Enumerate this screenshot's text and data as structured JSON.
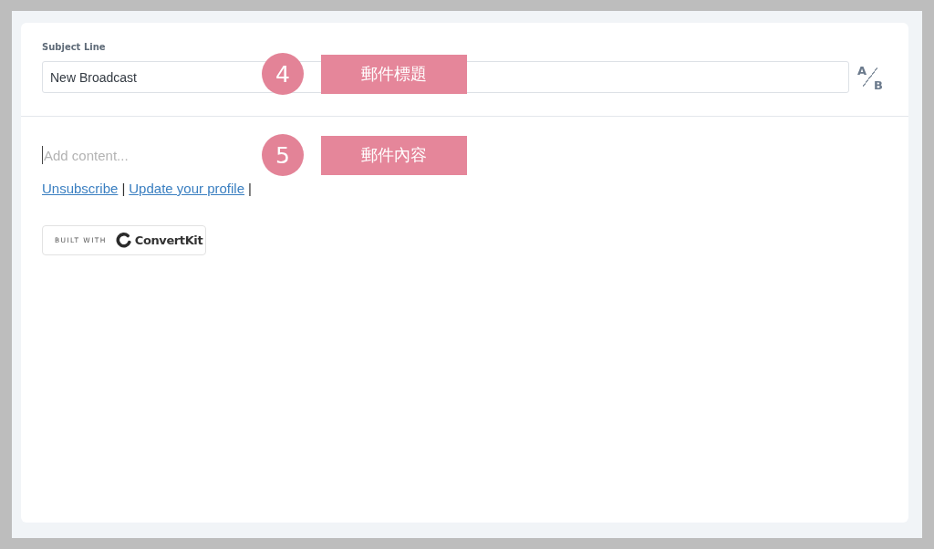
{
  "subject": {
    "label": "Subject Line",
    "value": "New Broadcast",
    "ab_test": {
      "first": "A",
      "second": "B"
    },
    "annotation": {
      "number": "4",
      "label": "郵件標題"
    }
  },
  "editor": {
    "placeholder": "Add content...",
    "footer": [
      {
        "kind": "link",
        "text": "Unsubscribe"
      },
      {
        "kind": "divider",
        "text": "|"
      },
      {
        "kind": "link",
        "text": "Update your profile"
      },
      {
        "kind": "divider",
        "text": "|"
      }
    ],
    "badge": {
      "prefix": "BUILT WITH",
      "brand": "ConvertKit"
    },
    "annotation": {
      "number": "5",
      "label": "郵件內容"
    }
  }
}
